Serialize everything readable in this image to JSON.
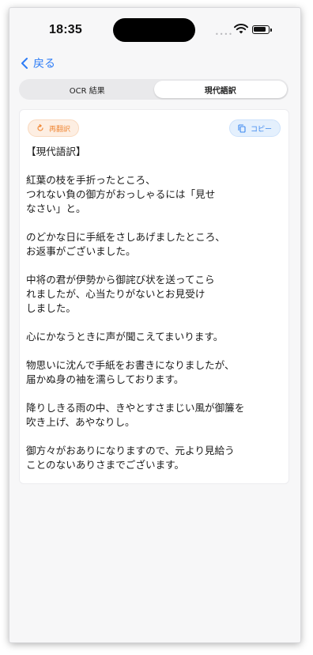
{
  "status_bar": {
    "time": "18:35"
  },
  "nav": {
    "back_label": "戻る"
  },
  "tabs": [
    {
      "label": "OCR 結果",
      "active": false
    },
    {
      "label": "現代語訳",
      "active": true
    }
  ],
  "actions": {
    "retranslate_label": "再翻訳",
    "copy_label": "コピー"
  },
  "translation": {
    "heading": "【現代語訳】",
    "paragraphs": [
      [
        "紅葉の枝を手折ったところ、",
        "つれない負の御方がおっしゃるには「見せ",
        "なさい」と。"
      ],
      [
        "のどかな日に手紙をさしあげましたところ、",
        "お返事がございました。"
      ],
      [
        "中将の君が伊勢から御詫び状を送ってこら",
        "れましたが、心当たりがないとお見受け",
        "しました。"
      ],
      [
        "心にかなうときに声が聞こえてまいります。"
      ],
      [
        "物思いに沈んで手紙をお書きになりましたが、",
        "届かぬ身の袖を濡らしております。"
      ],
      [
        "降りしきる雨の中、きやとすさまじい風が御簾を",
        "吹き上げ、あやなりし。"
      ],
      [
        "御方々がおありになりますので、元より見給う",
        "ことのないありさまでございます。"
      ]
    ]
  },
  "colors": {
    "accent_blue": "#2d7cf6",
    "orange": "#f08a3a",
    "copy_blue": "#3b87ef"
  }
}
